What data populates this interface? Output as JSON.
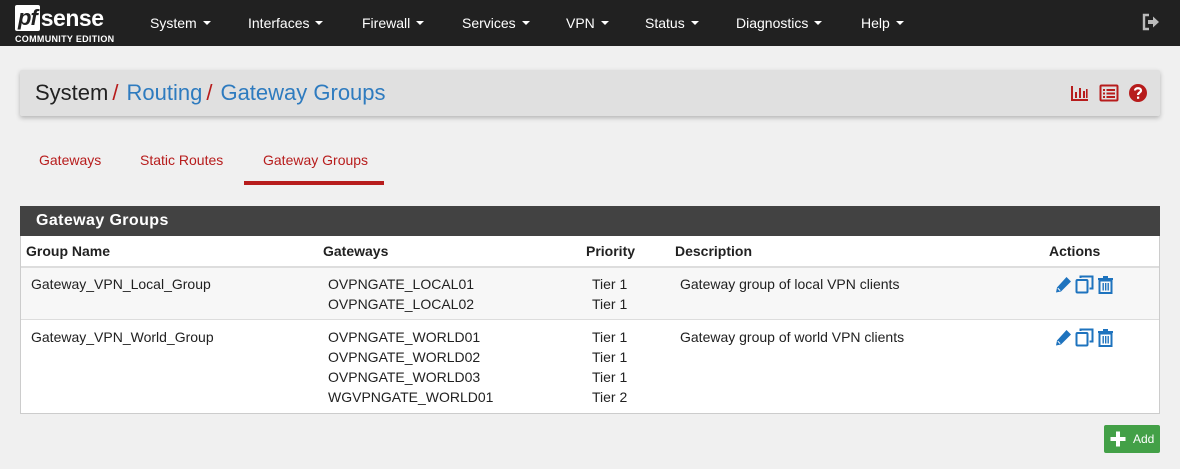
{
  "brand": {
    "logo_pf": "pf",
    "logo_sense": "sense",
    "edition": "COMMUNITY EDITION"
  },
  "nav": {
    "items": [
      {
        "label": "System"
      },
      {
        "label": "Interfaces"
      },
      {
        "label": "Firewall"
      },
      {
        "label": "Services"
      },
      {
        "label": "VPN"
      },
      {
        "label": "Status"
      },
      {
        "label": "Diagnostics"
      },
      {
        "label": "Help"
      }
    ],
    "logout_icon": "sign-out-icon"
  },
  "breadcrumb": {
    "root": "System",
    "separator": "/",
    "level2": "Routing",
    "level3": "Gateway Groups",
    "icons": [
      "bar-chart-icon",
      "list-icon",
      "help-icon"
    ]
  },
  "tabs": [
    {
      "label": "Gateways",
      "active": false
    },
    {
      "label": "Static Routes",
      "active": false
    },
    {
      "label": "Gateway Groups",
      "active": true
    }
  ],
  "panel": {
    "title": "Gateway Groups",
    "columns": [
      "Group Name",
      "Gateways",
      "Priority",
      "Description",
      "Actions"
    ],
    "rows": [
      {
        "name": "Gateway_VPN_Local_Group",
        "gateways": [
          "OVPNGATE_LOCAL01",
          "OVPNGATE_LOCAL02"
        ],
        "priorities": [
          "Tier 1",
          "Tier 1"
        ],
        "description": "Gateway group of local VPN clients",
        "actions": [
          "edit-icon",
          "copy-icon",
          "delete-icon"
        ]
      },
      {
        "name": "Gateway_VPN_World_Group",
        "gateways": [
          "OVPNGATE_WORLD01",
          "OVPNGATE_WORLD02",
          "OVPNGATE_WORLD03",
          "WGVPNGATE_WORLD01"
        ],
        "priorities": [
          "Tier 1",
          "Tier 1",
          "Tier 1",
          "Tier 2"
        ],
        "description": "Gateway group of world VPN clients",
        "actions": [
          "edit-icon",
          "copy-icon",
          "delete-icon"
        ]
      }
    ]
  },
  "add_button": {
    "label": "Add",
    "icon": "plus-icon"
  },
  "colors": {
    "navbar": "#212121",
    "accent_red": "#b71c1c",
    "link_blue": "#2e7bbf",
    "action_blue": "#1e73be",
    "add_green": "#43a047",
    "panel_heading": "#424242"
  }
}
